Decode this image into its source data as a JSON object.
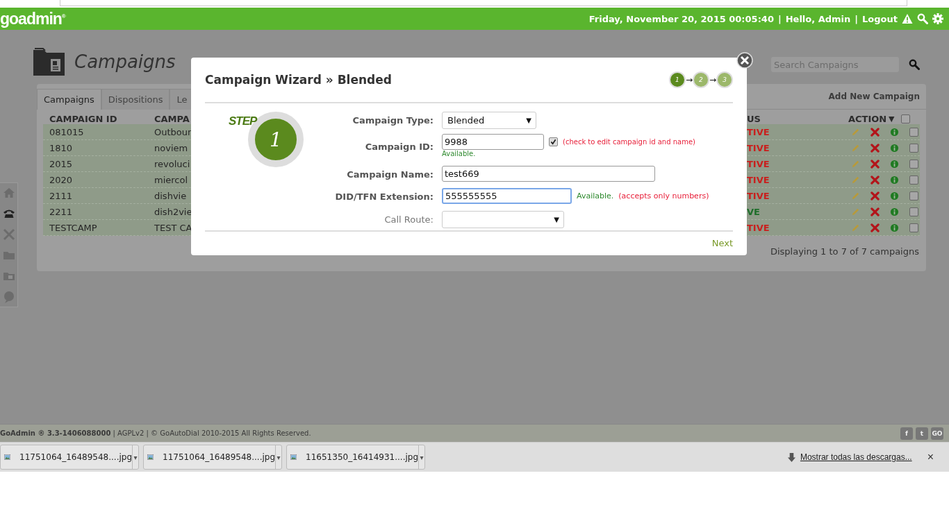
{
  "header": {
    "logo": "goadmin",
    "logo_mark": "®",
    "datetime": "Friday, November 20, 2015 00:05:40",
    "separator": "|",
    "greeting": "Hello, Admin",
    "logout": "Logout"
  },
  "page": {
    "title": "Campaigns",
    "search": {
      "placeholder": "Search Campaigns"
    }
  },
  "tabs": [
    {
      "label": "Campaigns",
      "selected": true
    },
    {
      "label": "Dispositions",
      "selected": false
    },
    {
      "label": "Le",
      "selected": false
    }
  ],
  "add_new": "Add New Campaign",
  "table": {
    "columns": [
      "CAMPAIGN ID",
      "CAMPA",
      "US",
      "ACTION"
    ],
    "sort_caret": "▼",
    "select_all_checked": false,
    "rows": [
      {
        "id": "081015",
        "name": "Outbour",
        "status": {
          "text": "TIVE",
          "color": "#c8201e"
        },
        "checked": false
      },
      {
        "id": "1810",
        "name": "noviem",
        "status": {
          "text": "TIVE",
          "color": "#c8201e"
        },
        "checked": false
      },
      {
        "id": "2015",
        "name": "revoluci",
        "status": {
          "text": "TIVE",
          "color": "#c8201e"
        },
        "checked": false
      },
      {
        "id": "2020",
        "name": "miercol",
        "status": {
          "text": "TIVE",
          "color": "#c8201e"
        },
        "checked": false
      },
      {
        "id": "2111",
        "name": "dishvie",
        "status": {
          "text": "TIVE",
          "color": "#c8201e"
        },
        "checked": false
      },
      {
        "id": "2211",
        "name": "dish2vie",
        "status": {
          "text": "VE",
          "color": "#1e6e2a"
        },
        "checked": false
      },
      {
        "id": "TESTCAMP",
        "name": "TEST CA",
        "status": {
          "text": "TIVE",
          "color": "#c8201e"
        },
        "checked": false
      }
    ]
  },
  "table_footer": "Displaying 1 to 7 of 7 campaigns",
  "modal": {
    "title": "Campaign Wizard » Blended",
    "steps": [
      {
        "label": "1",
        "arrow": "→",
        "selected": true
      },
      {
        "label": "2",
        "arrow": "→",
        "selected": false
      },
      {
        "label": "3",
        "selected": false
      }
    ],
    "step_badge": {
      "word": "STEP",
      "number": "1"
    },
    "fields": [
      {
        "kind": "select",
        "label": "Campaign Type:",
        "value": "Blended",
        "caret": "▼",
        "disabled": false
      },
      {
        "kind": "id",
        "label": "Campaign ID:",
        "value": "9988",
        "checked": true,
        "note": "(check to edit campaign id and name)",
        "status": "Available."
      },
      {
        "kind": "text",
        "label": "Campaign Name:",
        "value": "test669",
        "focused": false
      },
      {
        "kind": "extension",
        "label": "DID/TFN Extension:",
        "value": "555555555",
        "focused": true,
        "status": "Available.",
        "note": "(accepts only numbers)"
      },
      {
        "kind": "select",
        "label": "Call Route:",
        "caret": "▼",
        "disabled": true
      }
    ],
    "next": "Next"
  },
  "footer": {
    "text": "**GoAdmin ® 3.3-1406088000** | AGPLv2 | © GoAutoDial 2010-2015 All Rights Reserved.",
    "social": [
      "f",
      "t",
      "GO"
    ]
  },
  "downloads": {
    "items": [
      {
        "name": "11751064_16489548....jpg",
        "caret": "▾"
      },
      {
        "name": "11751064_16489548....jpg",
        "caret": "▾"
      },
      {
        "name": "11651350_16414931....jpg",
        "caret": "▾"
      }
    ],
    "show_all": "Mostrar todas las descargas...",
    "close": "×"
  }
}
